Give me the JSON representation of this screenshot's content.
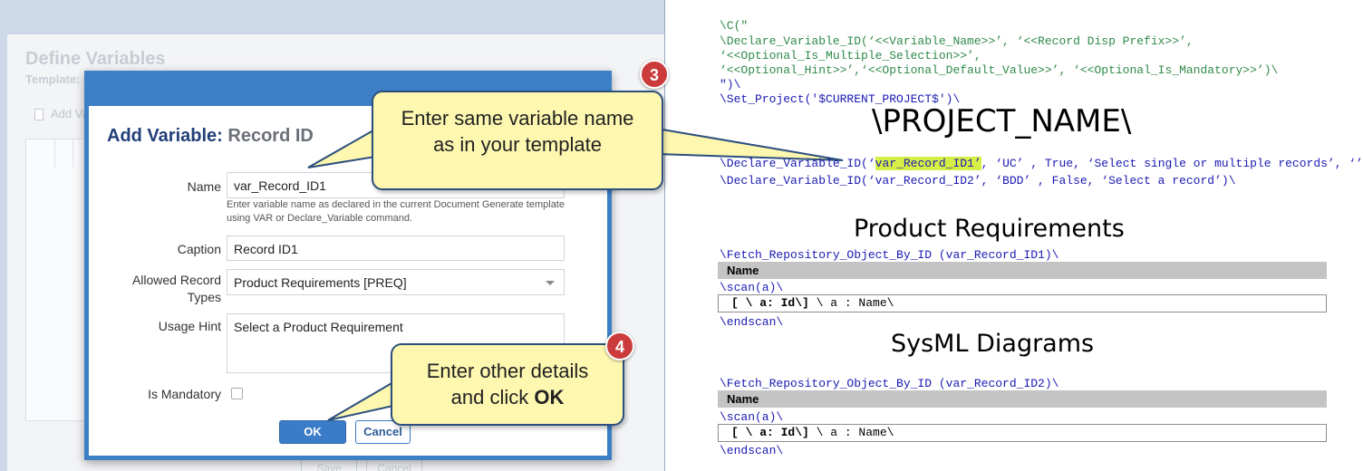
{
  "background_window": {
    "title": "Define Variables",
    "subtitle": "Template:",
    "add_label": "Add Va",
    "save_label": "Save",
    "cancel_label": "Cancel"
  },
  "dialog": {
    "title": "Add Variable:",
    "title_sub": "Record ID",
    "name_label": "Name",
    "name_value": "var_Record_ID1",
    "name_help": "Enter variable name as declared in the current Document Generate template using VAR or Declare_Variable command.",
    "caption_label": "Caption",
    "caption_value": "Record ID1",
    "allowed_label_line1": "Allowed Record",
    "allowed_label_line2": "Types",
    "allowed_value": "Product Requirements [PREQ]",
    "usage_label": "Usage Hint",
    "usage_value": "Select a Product Requirement",
    "mandatory_label": "Is Mandatory",
    "mandatory_checked": false,
    "ok_label": "OK",
    "cancel_label": "Cancel"
  },
  "callouts": {
    "c3": {
      "number": "3",
      "line1": "Enter same variable name",
      "line2": "as in your template"
    },
    "c4": {
      "number": "4",
      "line1": "Enter other details",
      "line2_pre": "and click ",
      "line2_bold": "OK"
    }
  },
  "template": {
    "lines": [
      "\\C(\"",
      " \\Declare_Variable_ID(‘<<Variable_Name>>’, ‘<<Record Disp Prefix>>’,",
      "‘<<Optional_Is_Multiple_Selection>>’,",
      "‘<<Optional_Hint>>’,‘<<Optional_Default_Value>>’, ‘<<Optional_Is_Mandatory>>’)\\",
      "\")\\",
      "\\Set_Project('$CURRENT_PROJECT$')\\"
    ],
    "project_heading": "\\PROJECT_NAME\\",
    "declare1_pre": "\\Declare_Variable_ID(‘",
    "declare1_hl": "var_Record_ID1’",
    "declare1_post": ", ‘UC’ , True, ‘Select single or multiple records’, ‘’)\\",
    "declare2": "\\Declare_Variable_ID(‘var_Record_ID2’, ‘BDD’ , False, ‘Select a record’)\\",
    "section1": {
      "heading": "Product Requirements",
      "fetch": "\\Fetch_Repository_Object_By_ID (var_Record_ID1)\\",
      "column": "Name",
      "scan": "\\scan(a)\\",
      "row_bold": "[ \\ a: Id\\]",
      "row_rest": " \\ a : Name\\",
      "endscan": "\\endscan\\"
    },
    "section2": {
      "heading": "SysML Diagrams",
      "fetch": "\\Fetch_Repository_Object_By_ID (var_Record_ID2)\\",
      "column": "Name",
      "scan": "\\scan(a)\\",
      "row_bold": "[ \\ a: Id\\]",
      "row_rest": " \\ a : Name\\",
      "endscan": "\\endscan\\"
    }
  },
  "colors": {
    "accent": "#3d7fc7",
    "callout_fill": "#fdf7b0",
    "badge": "#cb3b3b",
    "code_green": "#2f8a49",
    "code_blue": "#1a1ab3",
    "highlight": "#d7ee45"
  }
}
